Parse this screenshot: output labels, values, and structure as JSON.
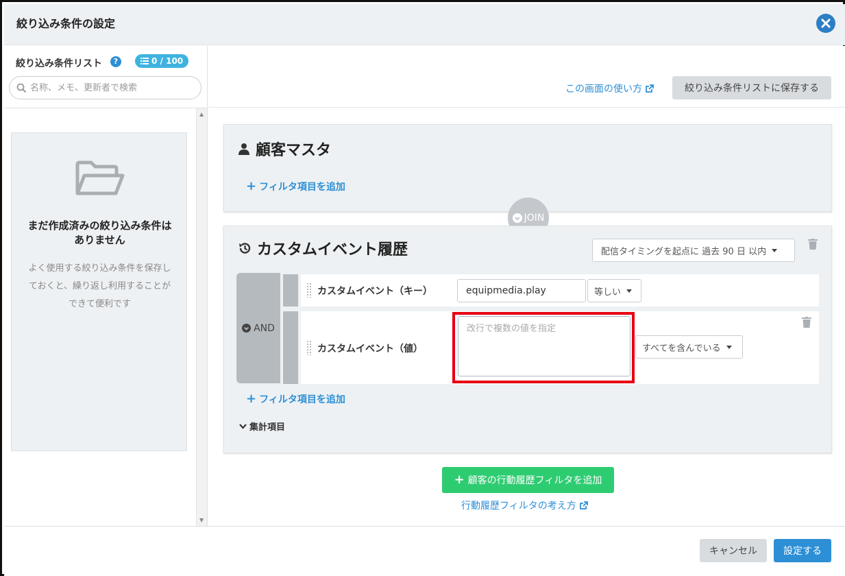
{
  "header": {
    "title": "絞り込み条件の設定"
  },
  "sidebar": {
    "title": "絞り込み条件リスト",
    "count_badge": "0 / 100",
    "search_placeholder": "名称、メモ、更新者で検索",
    "empty_title": "まだ作成済みの絞り込み条件はありません",
    "empty_description": "よく使用する絞り込み条件を保存しておくと、繰り返し利用することができて便利です"
  },
  "toolbar": {
    "howto_link": "この画面の使い方",
    "save_list_button": "絞り込み条件リストに保存する"
  },
  "master_card": {
    "title": "顧客マスタ",
    "add_filter": "フィルタ項目を追加"
  },
  "join_label": "JOIN",
  "event_card": {
    "title": "カスタムイベント履歴",
    "timing_select": "配信タイミングを起点に 過去 90 日 以内",
    "and_label": "AND",
    "rows": [
      {
        "label": "カスタムイベント（キー）",
        "value": "equipmedia.play",
        "operator": "等しい"
      },
      {
        "label": "カスタムイベント（値）",
        "placeholder": "改行で複数の値を指定",
        "operator": "すべてを含んでいる"
      }
    ],
    "add_filter": "フィルタ項目を追加",
    "aggregate": "集計項目"
  },
  "add_behavior_button": "顧客の行動履歴フィルタを追加",
  "concept_link": "行動履歴フィルタの考え方",
  "footer": {
    "cancel_button": "キャンセル",
    "apply_button": "設定する"
  },
  "colors": {
    "accent_blue": "#2d8fd6",
    "green": "#2ecc71",
    "highlight_red": "#e60012"
  }
}
